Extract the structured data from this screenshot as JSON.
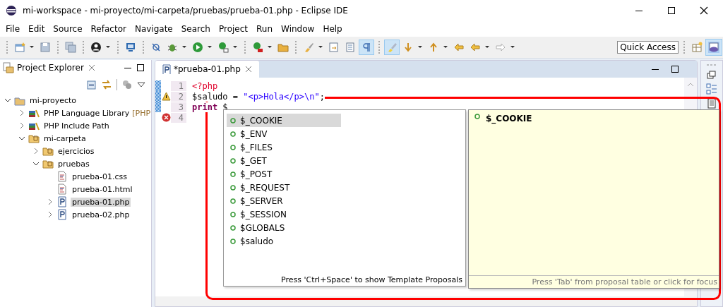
{
  "window": {
    "title": "mi-workspace - mi-proyecto/mi-carpeta/pruebas/prueba-01.php - Eclipse IDE"
  },
  "menu": [
    "File",
    "Edit",
    "Source",
    "Refactor",
    "Navigate",
    "Search",
    "Project",
    "Run",
    "Window",
    "Help"
  ],
  "toolbar": {
    "quick_access": "Quick Access"
  },
  "project_explorer": {
    "title": "Project Explorer",
    "tree": [
      {
        "label": "mi-proyecto",
        "kind": "project",
        "expanded": true,
        "selected": false,
        "children": [
          {
            "label": "PHP Language Library",
            "decoration": "[PHP",
            "kind": "library",
            "expanded": false,
            "selected": false
          },
          {
            "label": "PHP Include Path",
            "kind": "library",
            "expanded": false,
            "selected": false
          },
          {
            "label": "mi-carpeta",
            "kind": "folder",
            "expanded": true,
            "selected": false,
            "children": [
              {
                "label": "ejercicios",
                "kind": "folder",
                "expanded": false,
                "selected": false
              },
              {
                "label": "pruebas",
                "kind": "folder",
                "expanded": true,
                "selected": false,
                "children": [
                  {
                    "label": "prueba-01.css",
                    "kind": "file",
                    "selected": false
                  },
                  {
                    "label": "prueba-01.html",
                    "kind": "file",
                    "selected": false
                  },
                  {
                    "label": "prueba-01.php",
                    "kind": "php",
                    "expanded": false,
                    "selected": true
                  },
                  {
                    "label": "prueba-02.php",
                    "kind": "php",
                    "expanded": false,
                    "selected": false
                  }
                ]
              }
            ]
          }
        ]
      }
    ]
  },
  "editor": {
    "tab": {
      "label": "*prueba-01.php"
    },
    "lines": [
      {
        "number": "1",
        "changed": true,
        "warning": false,
        "error": false,
        "segments": [
          {
            "kind": "tag",
            "text": "<?php"
          }
        ]
      },
      {
        "number": "2",
        "changed": true,
        "warning": true,
        "error": false,
        "segments": [
          {
            "kind": "variable",
            "text": "$saludo"
          },
          {
            "kind": "plain",
            "text": " = "
          },
          {
            "kind": "string",
            "text": "\"<p>Hola</p>\\n\""
          },
          {
            "kind": "plain",
            "text": ";"
          }
        ]
      },
      {
        "number": "3",
        "changed": true,
        "warning": false,
        "error": false,
        "segments": [
          {
            "kind": "keyword",
            "text": "print"
          },
          {
            "kind": "plain",
            "text": " $"
          }
        ]
      },
      {
        "number": "4",
        "changed": false,
        "warning": false,
        "error": true
      }
    ]
  },
  "proposals": {
    "items": [
      {
        "label": "$_COOKIE",
        "selected": true
      },
      {
        "label": "$_ENV",
        "selected": false
      },
      {
        "label": "$_FILES",
        "selected": false
      },
      {
        "label": "$_GET",
        "selected": false
      },
      {
        "label": "$_POST",
        "selected": false
      },
      {
        "label": "$_REQUEST",
        "selected": false
      },
      {
        "label": "$_SERVER",
        "selected": false
      },
      {
        "label": "$_SESSION",
        "selected": false
      },
      {
        "label": "$GLOBALS",
        "selected": false
      },
      {
        "label": "$saludo",
        "selected": false
      }
    ],
    "footer": "Press 'Ctrl+Space' to show Template Proposals"
  },
  "info": {
    "title": "$_COOKIE",
    "footer": "Press 'Tab' from proposal table or click for focus"
  }
}
